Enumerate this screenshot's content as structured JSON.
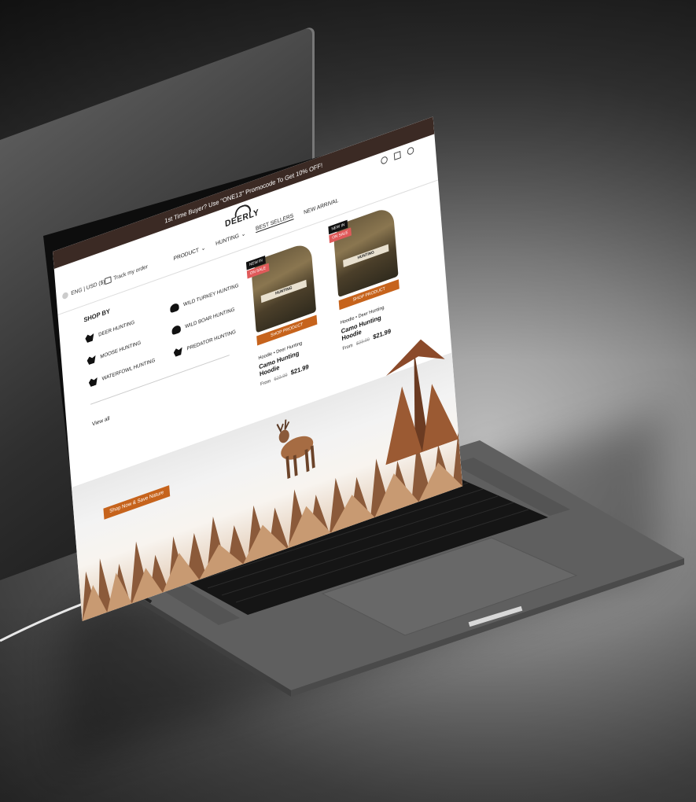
{
  "site": {
    "promo_text": "1st Time Buyer? Use \"ONE13\" Promocode To Get 10% OFF!",
    "brand": "DEERLY",
    "language_currency": "ENG | USD ($)",
    "track_order": "Track my order"
  },
  "nav": {
    "items": [
      {
        "label": "PRODUCT"
      },
      {
        "label": "HUNTING"
      },
      {
        "label": "BEST SELLERS"
      },
      {
        "label": "NEW ARRIVAL"
      }
    ]
  },
  "menu": {
    "title": "SHOP BY",
    "left": [
      {
        "label": "DEER HUNTING",
        "icon": "deer-icon"
      },
      {
        "label": "MOOSE HUNTING",
        "icon": "moose-icon"
      },
      {
        "label": "WATERFOWL HUNTING",
        "icon": "waterfowl-icon"
      }
    ],
    "right": [
      {
        "label": "WILD TURKEY HUNTING",
        "icon": "turkey-icon"
      },
      {
        "label": "WILD BOAR HUNTING",
        "icon": "boar-icon"
      },
      {
        "label": "PREDATOR HUNTING",
        "icon": "predator-icon"
      }
    ],
    "view_all": "View all"
  },
  "products": [
    {
      "badge_new": "NEW IN",
      "badge_sale": "ON SALE",
      "print_text": "HUNTING",
      "button": "SHOP PRODUCT",
      "category": "Hoodie",
      "subcategory": "Deer Hunting",
      "name": "Camo Hunting Hoodie",
      "from": "From",
      "old_price": "$23.99",
      "price": "$21.99"
    },
    {
      "badge_new": "NEW IN",
      "badge_sale": "ON SALE",
      "print_text": "HUNTING",
      "button": "SHOP PRODUCT",
      "category": "Hoodie",
      "subcategory": "Deer Hunting",
      "name": "Camo Hunting Hoodie",
      "from": "From",
      "old_price": "$23.99",
      "price": "$21.99"
    }
  ],
  "hero": {
    "cta": "Shop Now & Save Nature"
  },
  "colors": {
    "accent": "#c6631c",
    "promo_bar": "#3b2a24",
    "sale_badge": "#e05a5a"
  },
  "icons": [
    "search-icon",
    "bag-icon",
    "user-icon",
    "globe-icon",
    "truck-icon",
    "chevron-down-icon"
  ]
}
